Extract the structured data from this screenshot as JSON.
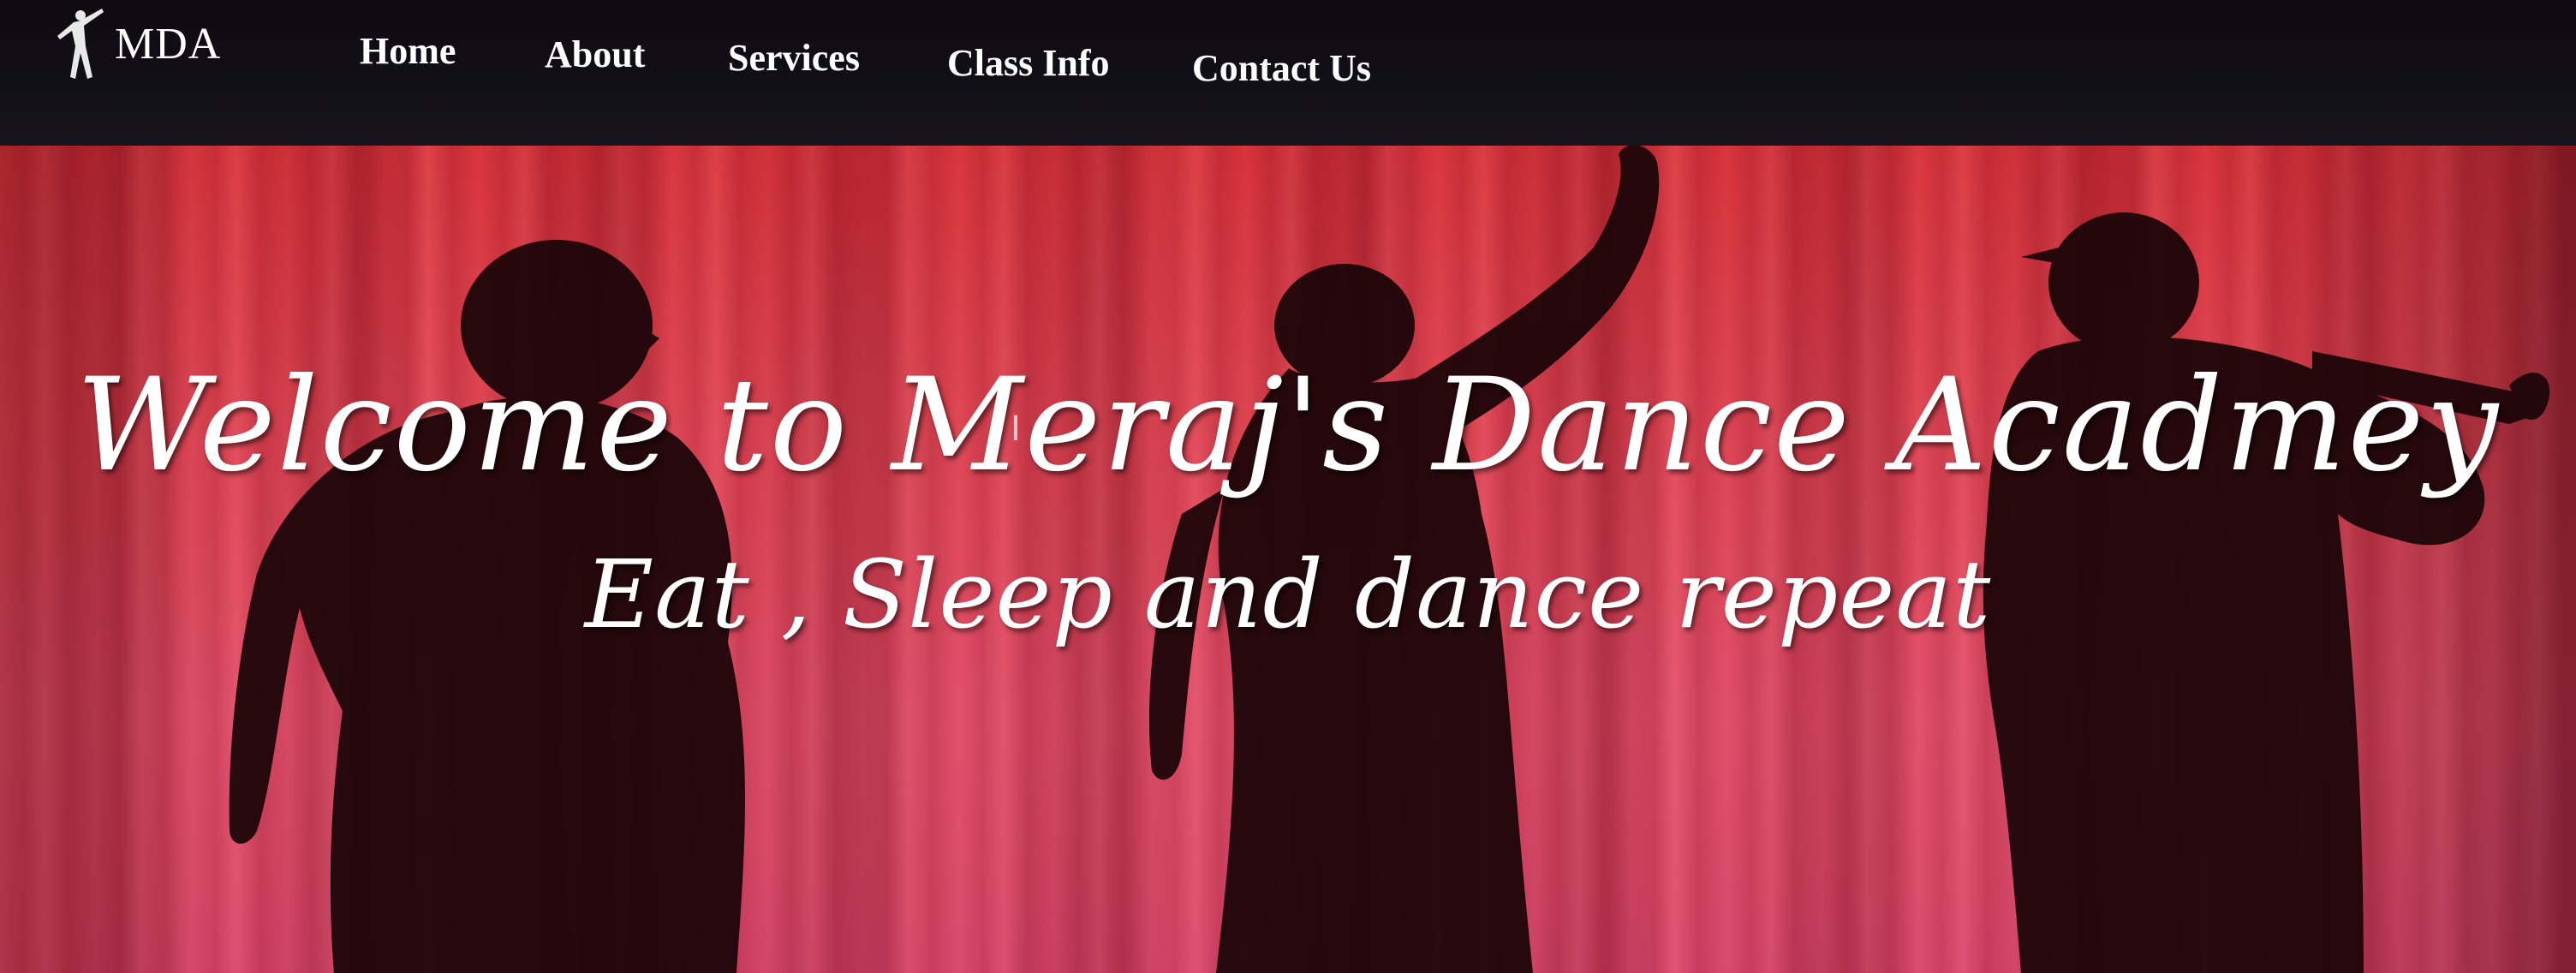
{
  "brand": {
    "logo_text": "MDA",
    "logo_icon": "dancer-icon"
  },
  "nav": {
    "items": [
      {
        "label": "Home"
      },
      {
        "label": "About"
      },
      {
        "label": "Services"
      },
      {
        "label": "Class Info"
      },
      {
        "label": "Contact Us"
      }
    ]
  },
  "hero": {
    "title": "Welcome to Meraj's Dance Acadmey",
    "subtitle": "Eat , Sleep and dance repeat",
    "background": "red-curtain-silhouettes",
    "cursor_icon": "text-cursor-icon"
  },
  "colors": {
    "nav_background": "#121017",
    "nav_text": "#ffffff",
    "curtain_red": "#df4654",
    "hero_text": "#ffffff",
    "silhouette": "#1a0508"
  }
}
